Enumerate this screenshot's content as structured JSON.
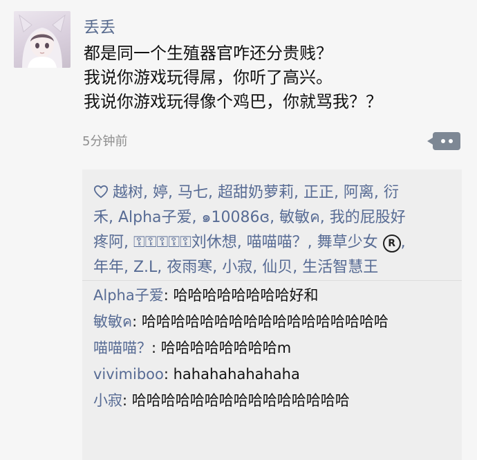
{
  "post": {
    "username": "丢丢",
    "lines": [
      "都是同一个生殖器官咋还分贵贱？",
      "我说你游戏玩得屌，你听了高兴。",
      "我说你游戏玩得像个鸡巴，你就骂我？？"
    ],
    "timestamp": "5分钟前"
  },
  "likes": {
    "lines": [
      "越树, 婷, 马七, 超甜奶萝莉, 正正, 阿离, 衍",
      "禾, Alpha子爱, ๑10086ɞ, 敏敏ค, 我的屁股好",
      "疼阿, ⚿⚿⚿⚿⚿刘休想, 喵喵喵？, 舞草少女",
      "年年, Z.L, 夜雨寒, 小寂, 仙贝, 生活智慧王"
    ],
    "registered_mark": "R"
  },
  "comments": [
    {
      "author": "Alpha子爱",
      "sep": ": ",
      "text": "哈哈哈哈哈哈哈哈好和"
    },
    {
      "author": "敏敏ค",
      "sep": ": ",
      "text": "哈哈哈哈哈哈哈哈哈哈哈哈哈哈哈哈哈"
    },
    {
      "author": "喵喵喵？",
      "sep": ": ",
      "text": "哈哈哈哈哈哈哈哈m"
    },
    {
      "author": "vivimiboo",
      "sep": ": ",
      "text": "hahahahahahaha"
    },
    {
      "author": "小寂",
      "sep": ": ",
      "text": "哈哈哈哈哈哈哈哈哈哈哈哈哈哈哈"
    }
  ],
  "colors": {
    "link": "#576b94",
    "background": "#f6f6f6",
    "panel": "#eeeeee",
    "button": "#7d8794"
  },
  "icons": {
    "avatar": "anime-avatar",
    "like": "heart-icon",
    "comment": "more-dots-icon"
  }
}
